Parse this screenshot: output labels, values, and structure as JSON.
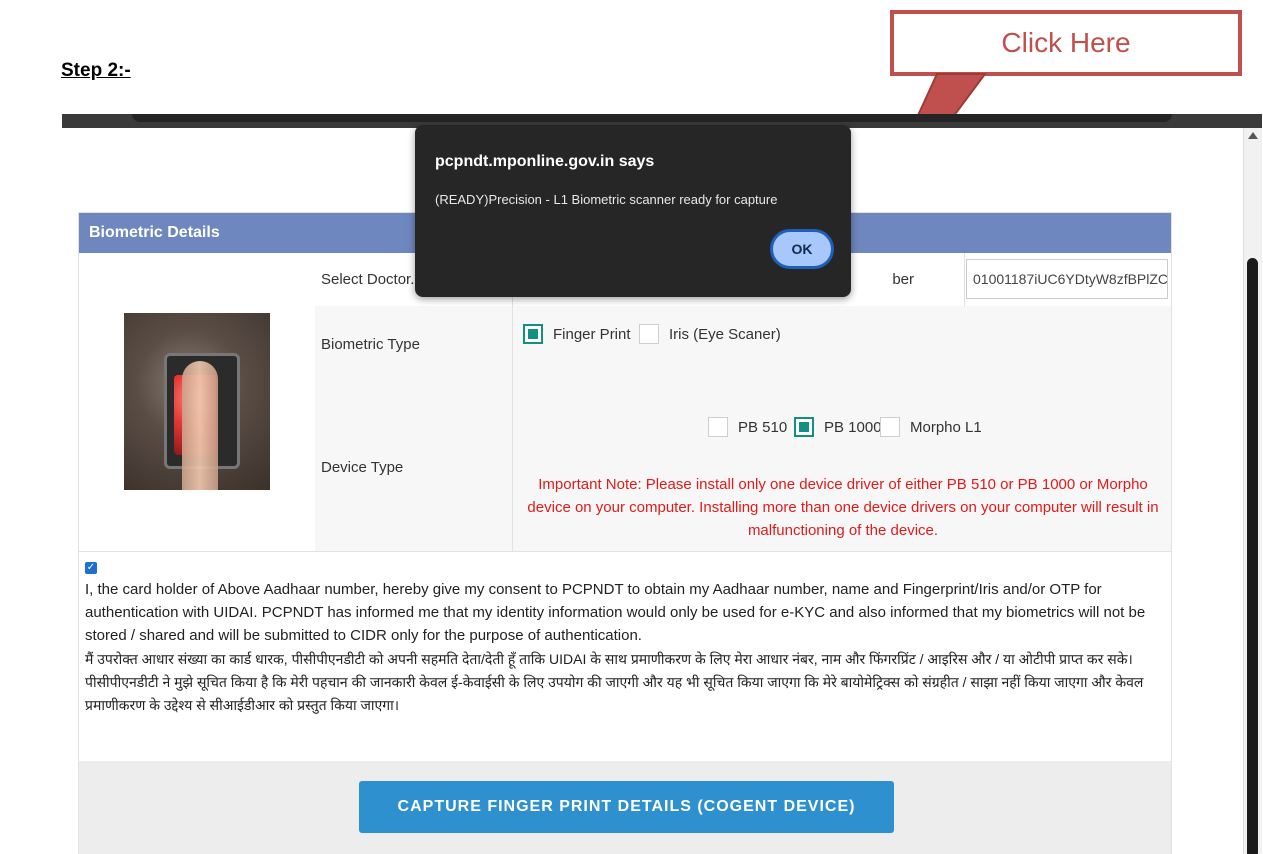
{
  "step_title": "Step 2:-",
  "callout": {
    "text": "Click Here",
    "color": "#c0504d"
  },
  "dialog": {
    "title": "pcpndt.mponline.gov.in says",
    "message": "(READY)Precision - L1 Biometric scanner ready for capture",
    "ok_label": "OK"
  },
  "panel": {
    "header": "Biometric Details",
    "header_color": "#6f87bf",
    "doctor_label": "Select Doctor.",
    "request_label": "ber",
    "request_value": "01001187iUC6YDtyW8zfBPlZC",
    "biometric_type": {
      "label": "Biometric Type",
      "options": [
        {
          "label": "Finger Print",
          "checked": true
        },
        {
          "label": "Iris (Eye Scaner)",
          "checked": false
        }
      ]
    },
    "device_type": {
      "label": "Device Type",
      "options": [
        {
          "label": "PB 510",
          "checked": false
        },
        {
          "label": "PB 1000",
          "checked": true
        },
        {
          "label": "Morpho L1",
          "checked": false
        }
      ],
      "note": "Important Note: Please install only one device driver of either PB 510 or PB 1000 or Morpho device on your computer. Installing more than one device drivers on your computer will result in malfunctioning of the device."
    }
  },
  "consent": {
    "checked": true,
    "english": "I, the card holder of Above Aadhaar number, hereby give my consent to PCPNDT to obtain my Aadhaar number, name and Fingerprint/Iris and/or OTP for authentication with UIDAI. PCPNDT has informed me that my identity information would only be used for e-KYC and also informed that my biometrics will not be stored / shared and will be submitted to CIDR only for the purpose of authentication.",
    "hindi": "मैं उपरोक्त आधार संख्या का कार्ड धारक, पीसीपीएनडीटी को अपनी सहमति देता/देती हूँ ताकि UIDAI के साथ प्रमाणीकरण के लिए मेरा आधार नंबर, नाम और फिंगरप्रिंट / आइरिस और / या ओटीपी प्राप्त कर सके। पीसीपीएनडीटी ने मुझे सूचित किया है कि मेरी पहचान की जानकारी केवल ई-केवाईसी के लिए उपयोग की जाएगी और यह भी सूचित किया जाएगा कि मेरे बायोमेट्रिक्स को संग्रहीत / साझा नहीं किया जाएगा और केवल प्रमाणीकरण के उद्देश्य से सीआईडीआर को प्रस्तुत किया जाएगा।"
  },
  "capture_button": "CAPTURE FINGER PRINT DETAILS (COGENT DEVICE)",
  "accent_color": "#2f90cf",
  "checked_color": "#148f83",
  "note_color": "#e01b1b"
}
